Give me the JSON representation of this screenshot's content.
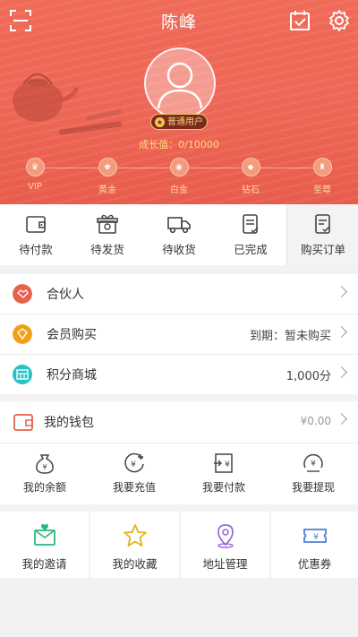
{
  "header": {
    "title": "陈峰",
    "user_level_badge": "普通用户",
    "growth_value": "成长值：0/10000",
    "levels": [
      "VIP",
      "黄金",
      "白金",
      "钻石",
      "至尊"
    ]
  },
  "orders": [
    {
      "label": "待付款",
      "icon": "wallet-icon"
    },
    {
      "label": "待发货",
      "icon": "gift-box-icon"
    },
    {
      "label": "待收货",
      "icon": "truck-icon"
    },
    {
      "label": "已完成",
      "icon": "clipboard-done-icon"
    },
    {
      "label": "购买订单",
      "icon": "clipboard-check-icon"
    }
  ],
  "menu": [
    {
      "label": "合伙人",
      "value": "",
      "color": "#e8604e"
    },
    {
      "label": "会员购买",
      "value": "到期：暂未购买",
      "color": "#f0a019"
    },
    {
      "label": "积分商城",
      "value": "1,000分",
      "color": "#25c2c6"
    }
  ],
  "wallet": {
    "label": "我的钱包",
    "value": "¥0.00",
    "ops": [
      "我的余额",
      "我要充值",
      "我要付款",
      "我要提现"
    ]
  },
  "grid": [
    {
      "label": "我的邀请",
      "color": "#2db87a"
    },
    {
      "label": "我的收藏",
      "color": "#e2b21c"
    },
    {
      "label": "地址管理",
      "color": "#9a6ad9"
    },
    {
      "label": "优惠券",
      "color": "#4c7fd6"
    }
  ],
  "colors": {
    "header": "#ee6655",
    "accent_gold": "#f5c45a"
  }
}
